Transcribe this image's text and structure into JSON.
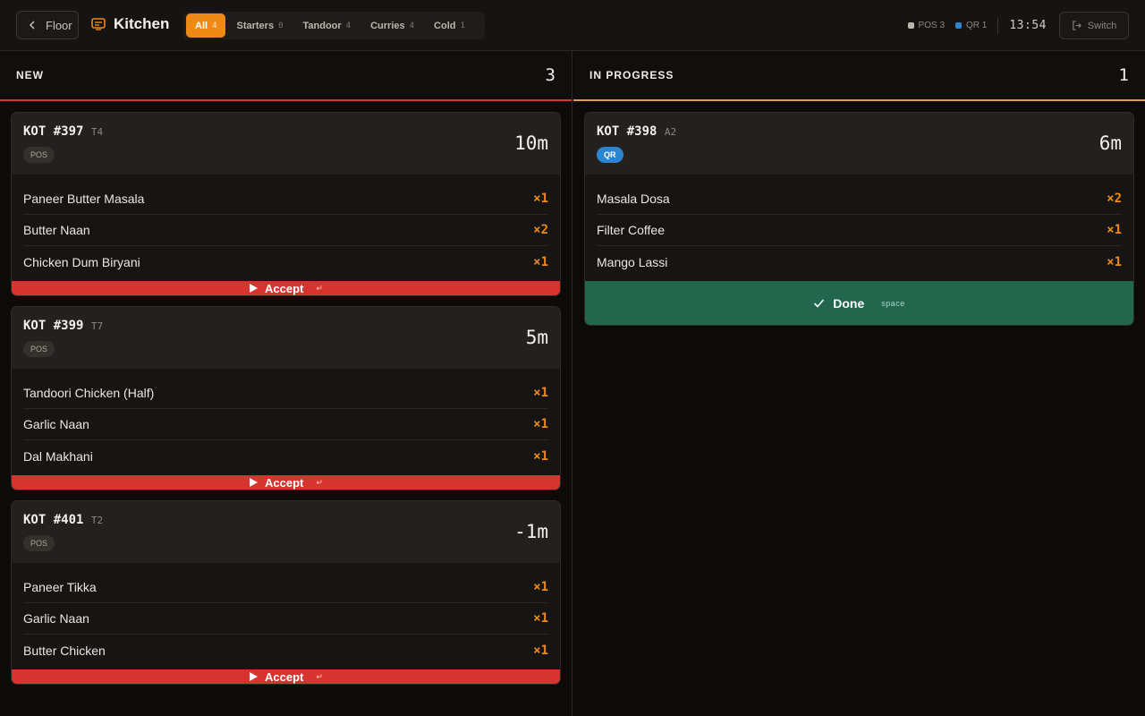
{
  "colors": {
    "accent": "#ef8a14",
    "new": "#d8342f",
    "progress": "#e59a4c",
    "done": "#22664e",
    "qr": "#2c86cf"
  },
  "topbar": {
    "back_label": "Floor",
    "title": "Kitchen",
    "filters": [
      {
        "label": "All",
        "count": "4",
        "active": true
      },
      {
        "label": "Starters",
        "count": "0"
      },
      {
        "label": "Tandoor",
        "count": "4"
      },
      {
        "label": "Curries",
        "count": "4"
      },
      {
        "label": "Cold",
        "count": "1"
      }
    ],
    "sources": [
      {
        "label": "POS 3",
        "color": "#bdb6ae"
      },
      {
        "label": "QR 1",
        "color": "#2c86cf"
      }
    ],
    "clock": "13:54",
    "switch_label": "Switch"
  },
  "columns": {
    "new": {
      "title": "NEW",
      "count": "3",
      "tickets": [
        {
          "id": "KOT #397",
          "table": "T4",
          "source": "POS",
          "elapsed": "10m",
          "items": [
            {
              "name": "Paneer Butter Masala",
              "qty": "×1"
            },
            {
              "name": "Butter Naan",
              "qty": "×2"
            },
            {
              "name": "Chicken Dum Biryani",
              "qty": "×1"
            }
          ],
          "action": "Accept",
          "shortcut": "↵"
        },
        {
          "id": "KOT #399",
          "table": "T7",
          "source": "POS",
          "elapsed": "5m",
          "items": [
            {
              "name": "Tandoori Chicken (Half)",
              "qty": "×1"
            },
            {
              "name": "Garlic Naan",
              "qty": "×1"
            },
            {
              "name": "Dal Makhani",
              "qty": "×1"
            }
          ],
          "action": "Accept",
          "shortcut": "↵"
        },
        {
          "id": "KOT #401",
          "table": "T2",
          "source": "POS",
          "elapsed": "-1m",
          "items": [
            {
              "name": "Paneer Tikka",
              "qty": "×1"
            },
            {
              "name": "Garlic Naan",
              "qty": "×1"
            },
            {
              "name": "Butter Chicken",
              "qty": "×1"
            }
          ],
          "action": "Accept",
          "shortcut": "↵"
        }
      ]
    },
    "progress": {
      "title": "IN PROGRESS",
      "count": "1",
      "tickets": [
        {
          "id": "KOT #398",
          "table": "A2",
          "source": "QR",
          "elapsed": "6m",
          "items": [
            {
              "name": "Masala Dosa",
              "qty": "×2"
            },
            {
              "name": "Filter Coffee",
              "qty": "×1"
            },
            {
              "name": "Mango Lassi",
              "qty": "×1"
            }
          ],
          "action": "Done",
          "shortcut": "space"
        }
      ]
    }
  }
}
